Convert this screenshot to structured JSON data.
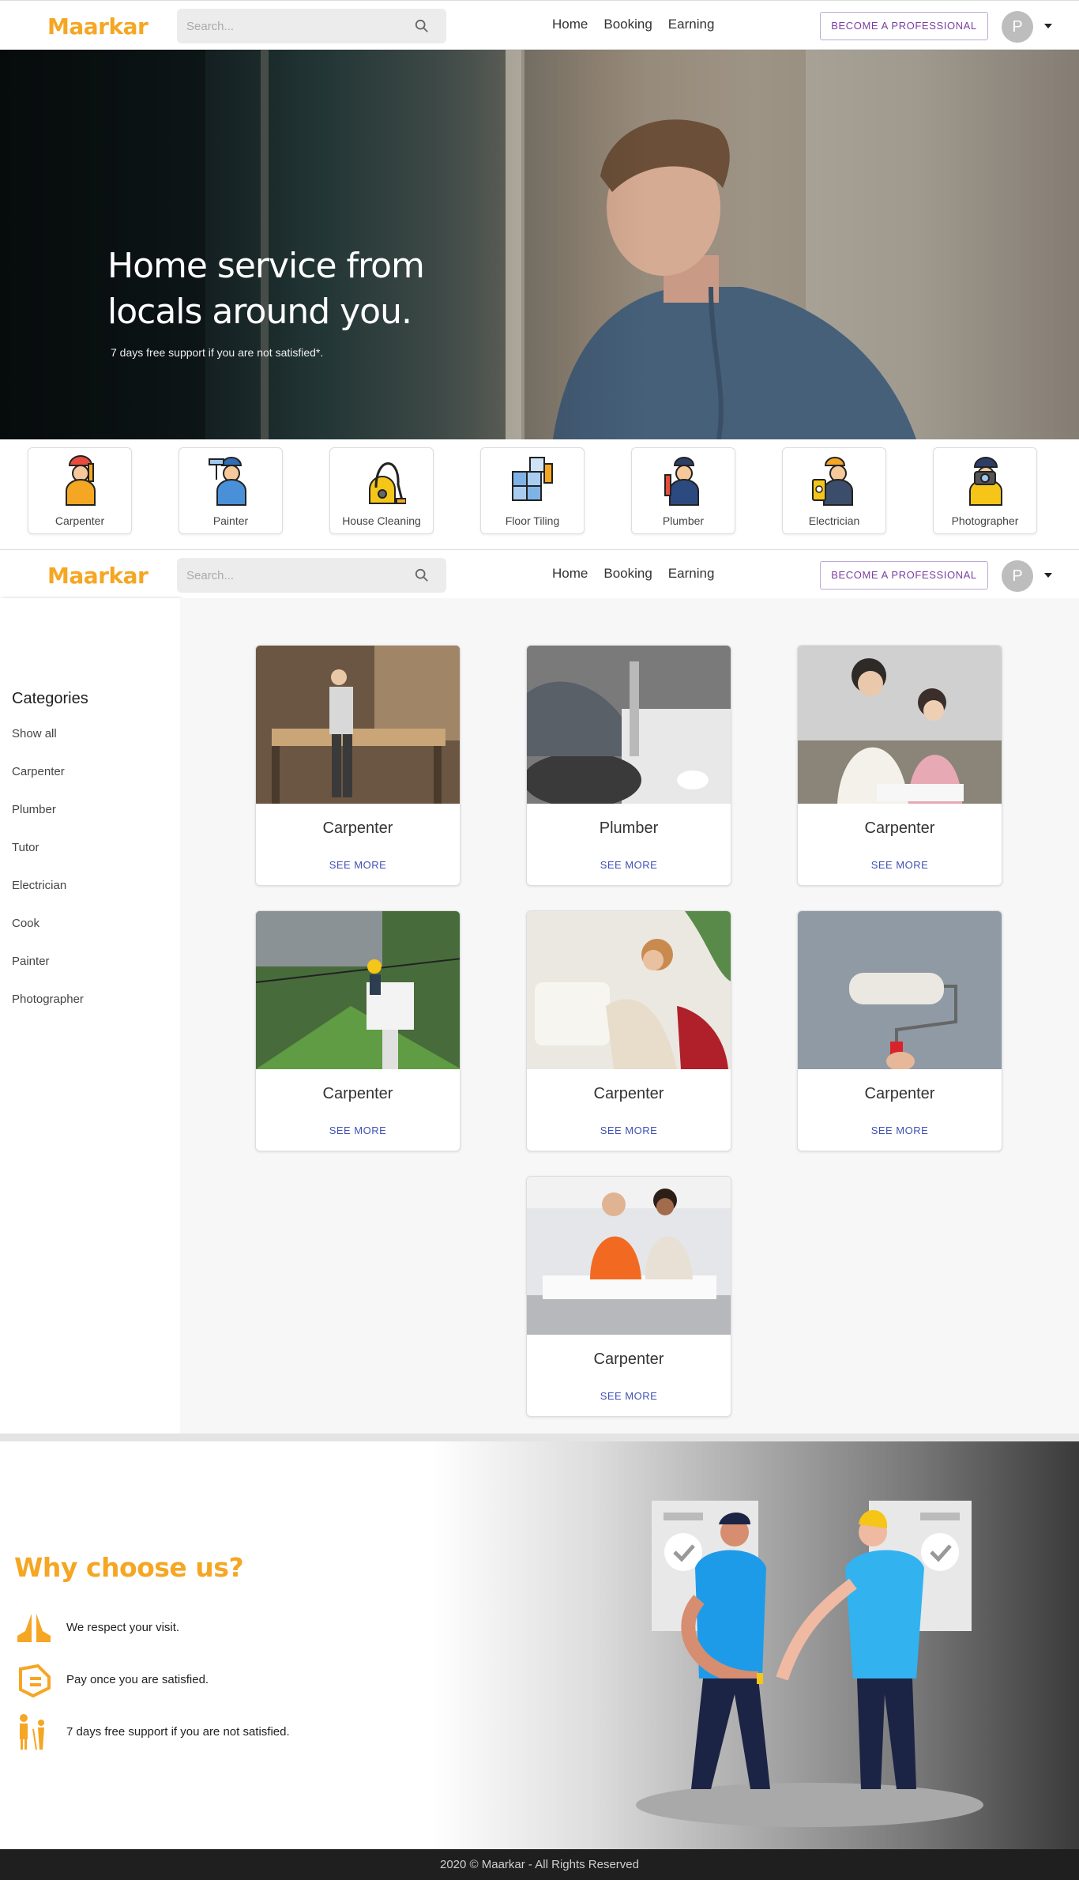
{
  "brand": {
    "name": "Maarkar",
    "accent": "#f5a623",
    "link_color": "#3f51b5",
    "pro_color": "#7b3fa1"
  },
  "navbar": {
    "search_placeholder": "Search...",
    "links": [
      "Home",
      "Booking",
      "Earning"
    ],
    "pro_button": "BECOME A PROFESSIONAL",
    "avatar_initial": "P"
  },
  "hero": {
    "title": "Home service from locals around you.",
    "subtitle": "7 days free support if you are not satisfied*."
  },
  "category_strip": [
    {
      "label": "Carpenter",
      "icon": "carpenter-icon"
    },
    {
      "label": "Painter",
      "icon": "painter-icon"
    },
    {
      "label": "House Cleaning",
      "icon": "vacuum-icon"
    },
    {
      "label": "Floor Tiling",
      "icon": "tiling-icon"
    },
    {
      "label": "Plumber",
      "icon": "plumber-icon"
    },
    {
      "label": "Electrician",
      "icon": "electrician-icon"
    },
    {
      "label": "Photographer",
      "icon": "photographer-icon"
    }
  ],
  "sidebar": {
    "title": "Categories",
    "items": [
      "Show all",
      "Carpenter",
      "Plumber",
      "Tutor",
      "Electrician",
      "Cook",
      "Painter",
      "Photographer"
    ]
  },
  "services": [
    {
      "title": "Carpenter",
      "link": "SEE MORE"
    },
    {
      "title": "Plumber",
      "link": "SEE MORE"
    },
    {
      "title": "Carpenter",
      "link": "SEE MORE"
    },
    {
      "title": "Carpenter",
      "link": "SEE MORE"
    },
    {
      "title": "Carpenter",
      "link": "SEE MORE"
    },
    {
      "title": "Carpenter",
      "link": "SEE MORE"
    },
    {
      "title": "Carpenter",
      "link": "SEE MORE"
    }
  ],
  "why": {
    "title": "Why choose us?",
    "items": [
      {
        "text": "We respect your visit.",
        "icon": "praying-hands-icon"
      },
      {
        "text": "Pay once you are satisfied.",
        "icon": "payment-tag-icon"
      },
      {
        "text": "7 days free support if you are not satisfied.",
        "icon": "support-people-icon"
      }
    ]
  },
  "footer": {
    "text": "2020 © Maarkar - All Rights Reserved"
  }
}
